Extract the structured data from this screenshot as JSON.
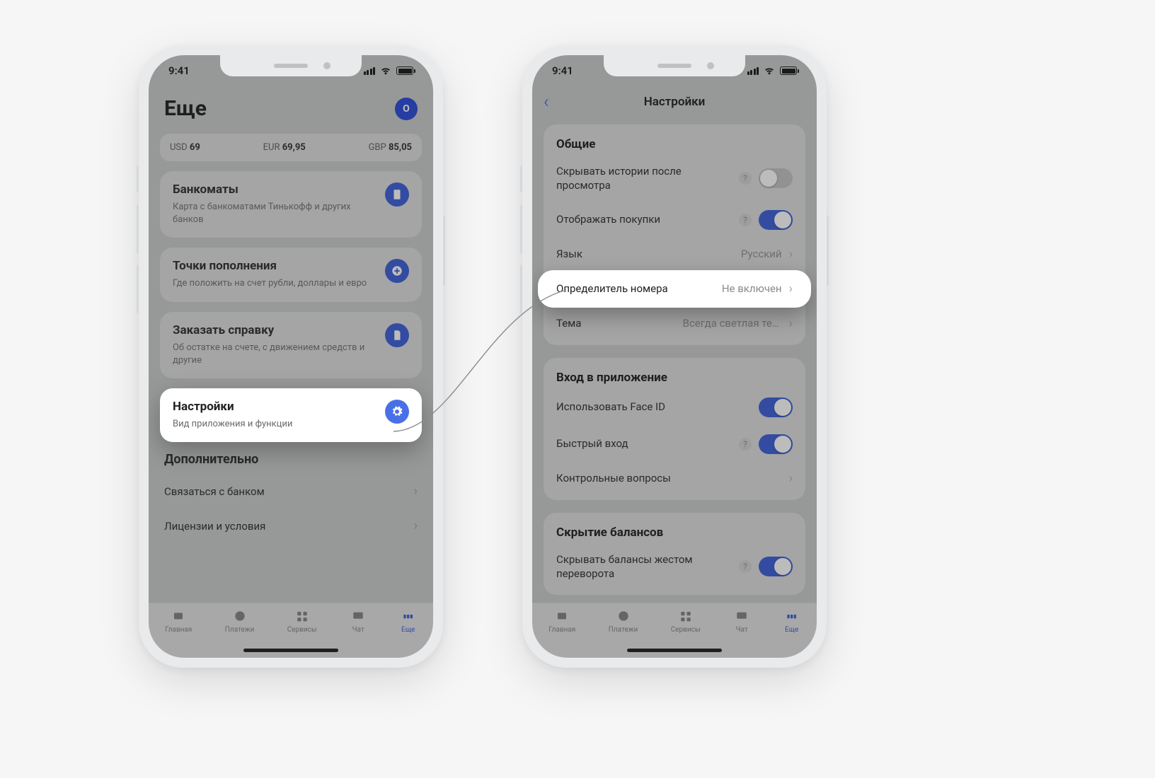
{
  "status": {
    "time": "9:41"
  },
  "phone1": {
    "title": "Еще",
    "profile_letter": "O",
    "rates": [
      {
        "code": "USD",
        "value": "69"
      },
      {
        "code": "EUR",
        "value": "69,95"
      },
      {
        "code": "GBP",
        "value": "85,05"
      }
    ],
    "cards": [
      {
        "title": "Банкоматы",
        "subtitle": "Карта с банкоматами Тинькофф и других банков",
        "icon": "atm"
      },
      {
        "title": "Точки пополнения",
        "subtitle": "Где положить на счет рубли, доллары и евро",
        "icon": "plus"
      },
      {
        "title": "Заказать справку",
        "subtitle": "Об остатке на счете, с движением средств и другие",
        "icon": "doc"
      },
      {
        "title": "Настройки",
        "subtitle": "Вид приложения и функции",
        "icon": "gear",
        "highlighted": true
      }
    ],
    "extra_header": "Дополнительно",
    "extra": [
      {
        "label": "Связаться с банком"
      },
      {
        "label": "Лицензии и условия"
      }
    ],
    "tabs": [
      {
        "label": "Главная"
      },
      {
        "label": "Платежи"
      },
      {
        "label": "Сервисы"
      },
      {
        "label": "Чат"
      },
      {
        "label": "Еще",
        "active": true
      }
    ]
  },
  "phone2": {
    "nav_title": "Настройки",
    "groups": [
      {
        "title": "Общие",
        "rows": [
          {
            "label": "Скрывать истории после просмотра",
            "help": true,
            "toggle": false
          },
          {
            "label": "Отображать покупки",
            "help": true,
            "toggle": true
          },
          {
            "label": "Язык",
            "value": "Русский",
            "chevron": true
          },
          {
            "label": "Определитель номера",
            "value": "Не включен",
            "chevron": true,
            "highlighted": true
          },
          {
            "label": "Тема",
            "value": "Всегда светлая тема",
            "chevron": true
          }
        ]
      },
      {
        "title": "Вход в приложение",
        "rows": [
          {
            "label": "Использовать Face ID",
            "toggle": true
          },
          {
            "label": "Быстрый вход",
            "help": true,
            "toggle": true
          },
          {
            "label": "Контрольные вопросы",
            "chevron": true
          }
        ]
      },
      {
        "title": "Скрытие балансов",
        "rows": [
          {
            "label": "Скрывать балансы жестом переворота",
            "help": true,
            "toggle": true
          }
        ]
      }
    ],
    "tabs": [
      {
        "label": "Главная"
      },
      {
        "label": "Платежи"
      },
      {
        "label": "Сервисы"
      },
      {
        "label": "Чат"
      },
      {
        "label": "Еще",
        "active": true
      }
    ]
  }
}
